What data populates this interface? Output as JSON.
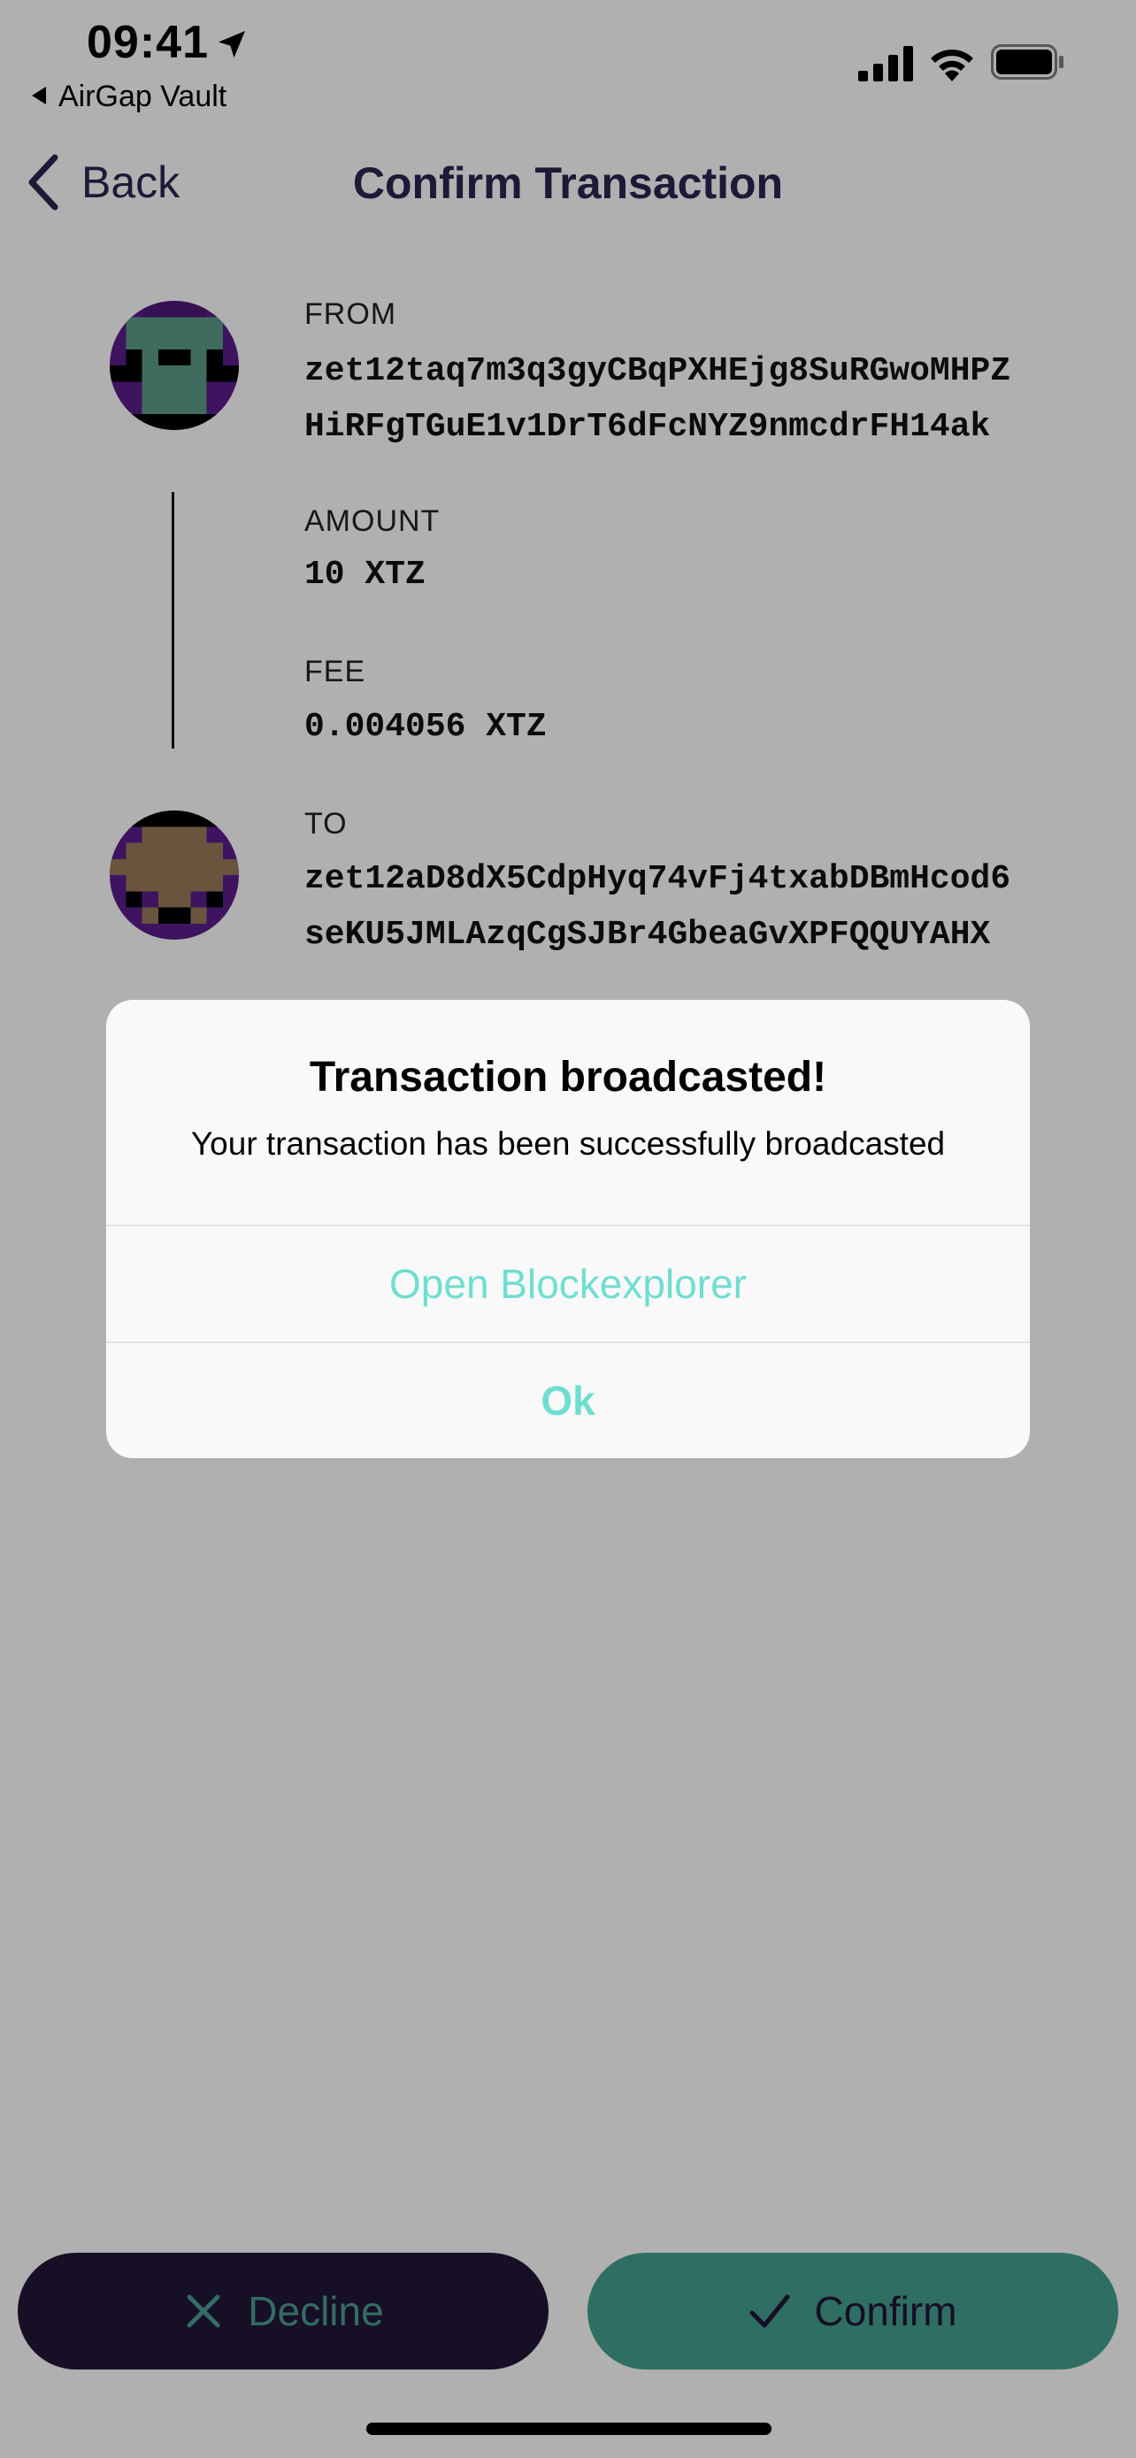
{
  "status_bar": {
    "time": "09:41",
    "back_app": "AirGap Vault",
    "icons": [
      "location-arrow-icon",
      "cellular-signal-icon",
      "wifi-icon",
      "battery-icon"
    ]
  },
  "nav": {
    "back_label": "Back",
    "title": "Confirm Transaction"
  },
  "transaction": {
    "from_label": "FROM",
    "from_address_line1": "zet12taq7m3q3gyCBqPXHEjg8SuRGwoMHPZ",
    "from_address_line2": "HiRFgTGuE1v1DrT6dFcNYZ9nmcdrFH14ak",
    "amount_label": "AMOUNT",
    "amount_value": "10 XTZ",
    "fee_label": "FEE",
    "fee_value": "0.004056 XTZ",
    "to_label": "TO",
    "to_address_line1": "zet12aD8dX5CdpHyq74vFj4txabDBmHcod6",
    "to_address_line2": "seKU5JMLAzqCgSJBr4GbeaGvXPFQQUYAHX"
  },
  "alert": {
    "title": "Transaction broadcasted!",
    "message": "Your transaction has been successfully broadcasted",
    "open_explorer_label": "Open Blockexplorer",
    "ok_label": "Ok"
  },
  "actions": {
    "decline_label": "Decline",
    "confirm_label": "Confirm"
  },
  "colors": {
    "accent": "#6fded0",
    "nav_text": "#2b2750",
    "decline_bg": "#211637",
    "confirm_bg": "#45a090"
  }
}
